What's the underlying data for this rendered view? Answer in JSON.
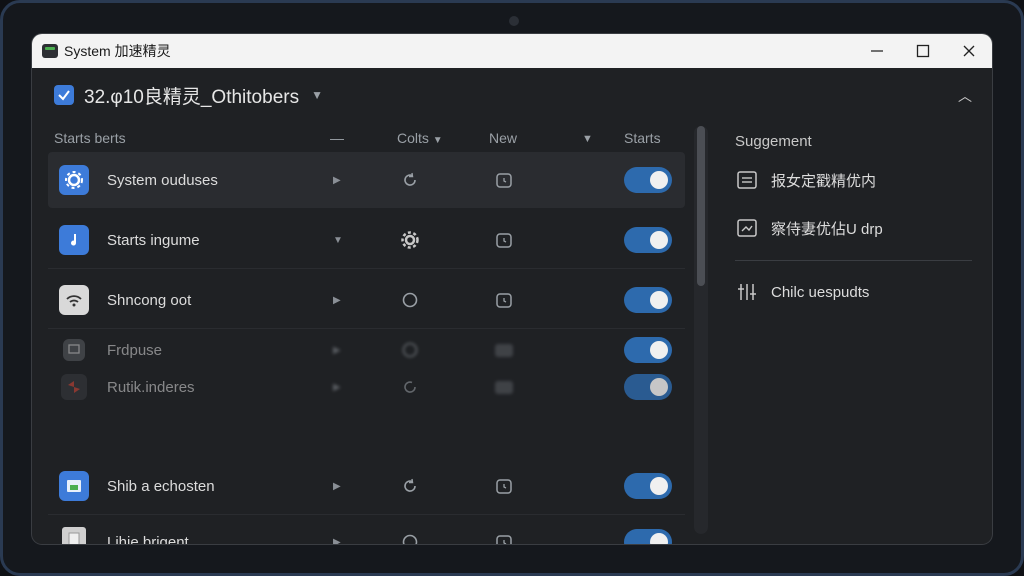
{
  "window": {
    "title": "System 加速精灵"
  },
  "header": {
    "profile_name": "32.φ10良精灵_Othitobers"
  },
  "columns": {
    "name": "Starts berts",
    "dash": "—",
    "colts": "Colts",
    "new": "New",
    "starts": "Starts"
  },
  "rows": [
    {
      "name": "System ouduses",
      "icon": "gear-icon",
      "icon_color": "#3d7bd9",
      "enabled": true
    },
    {
      "name": "Starts ingume",
      "icon": "music-note-icon",
      "icon_color": "#3d7bd9",
      "enabled": true
    },
    {
      "name": "Shncong oot",
      "icon": "wifi-icon",
      "icon_color": "#d9d9d9",
      "enabled": true
    },
    {
      "name": "Frdpuse",
      "icon": "monitor-icon",
      "icon_color": "#5a5d63",
      "enabled": true
    },
    {
      "name": "Rutik.inderes",
      "icon": "pinwheel-icon",
      "icon_color": "#3a3c40",
      "enabled": true
    },
    {
      "name": "Shib a echosten",
      "icon": "image-icon",
      "icon_color": "#3d7bd9",
      "enabled": true
    },
    {
      "name": "Lihie brigent",
      "icon": "box-icon",
      "icon_color": "#cfcfcf",
      "enabled": true
    }
  ],
  "sidebar": {
    "title": "Suggement",
    "items": [
      {
        "label": "报女定戳精优内",
        "icon": "list-panel-icon"
      },
      {
        "label": "察侍妻优佔U drp",
        "icon": "scan-image-icon"
      },
      {
        "label": "Chilc uespudts",
        "icon": "sliders-icon"
      }
    ]
  },
  "colors": {
    "accent": "#2d6aad",
    "brand_blue": "#3d7bd9"
  }
}
